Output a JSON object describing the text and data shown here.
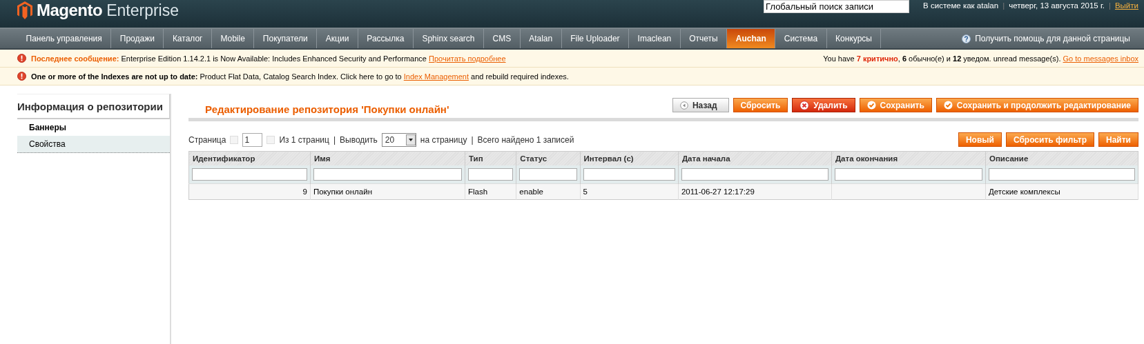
{
  "header": {
    "logo": "Magento",
    "logo_suffix": "Enterprise",
    "search_value": "Глобальный поиск записи",
    "user": "В системе как atalan",
    "sep": "|",
    "date": "четверг, 13 августа 2015 г.",
    "sep2": "|",
    "logout": "Выйти"
  },
  "nav": {
    "items": [
      {
        "label": "Панель управления",
        "selected": false
      },
      {
        "label": "Продажи",
        "selected": false
      },
      {
        "label": "Каталог",
        "selected": false
      },
      {
        "label": "Mobile",
        "selected": false
      },
      {
        "label": "Покупатели",
        "selected": false
      },
      {
        "label": "Акции",
        "selected": false
      },
      {
        "label": "Рассылка",
        "selected": false
      },
      {
        "label": "Sphinx search",
        "selected": false
      },
      {
        "label": "CMS",
        "selected": false
      },
      {
        "label": "Atalan",
        "selected": false
      },
      {
        "label": "File Uploader",
        "selected": false
      },
      {
        "label": "Imaclean",
        "selected": false
      },
      {
        "label": "Отчеты",
        "selected": false
      },
      {
        "label": "Auchan",
        "selected": true
      },
      {
        "label": "Система",
        "selected": false
      },
      {
        "label": "Конкурсы",
        "selected": false
      }
    ],
    "help": "Получить помощь для данной страницы"
  },
  "messages": [
    {
      "lead": "Последнее сообщение:",
      "text": "Enterprise Edition 1.14.2.1 is Now Available: Includes Enhanced Security and Performance",
      "link": "Прочитать подробнее",
      "summary": [
        {
          "kind": "plain",
          "text": "You have "
        },
        {
          "kind": "critical",
          "text": "7 критично"
        },
        {
          "kind": "plain",
          "text": ", "
        },
        {
          "kind": "bold",
          "text": "6"
        },
        {
          "kind": "plain",
          "text": " обычно(е) и "
        },
        {
          "kind": "bold",
          "text": "12"
        },
        {
          "kind": "plain",
          "text": " уведом. unread message(s). "
        }
      ],
      "summary_link": "Go to messages inbox"
    },
    {
      "lead": "One or more of the Indexes are not up to date:",
      "text": "Product Flat Data, Catalog Search Index. Click here to go to",
      "link": "Index Management",
      "after": "and rebuild required indexes."
    }
  ],
  "sidebar": {
    "title": "Информация о репозитории",
    "items": [
      {
        "label": "Баннеры",
        "selected": true
      },
      {
        "label": "Свойства",
        "selected": false
      }
    ]
  },
  "page": {
    "title": "Редактирование репозитория 'Покупки онлайн'",
    "buttons": [
      {
        "kind": "back",
        "label": "Назад"
      },
      {
        "kind": "plain",
        "label": "Сбросить"
      },
      {
        "kind": "delete",
        "label": "Удалить"
      },
      {
        "kind": "save",
        "label": "Сохранить"
      },
      {
        "kind": "save",
        "label": "Сохранить и продолжить редактирование"
      }
    ]
  },
  "pager": {
    "page_label": "Страница",
    "page": "1",
    "of": "Из 1 страниц",
    "sep": "|",
    "show_label": "Выводить",
    "per_page": "20",
    "per_page_suffix": "на страницу",
    "sep2": "|",
    "total": "Всего найдено 1 записей",
    "buttons": [
      "Новый",
      "Сбросить фильтр",
      "Найти"
    ]
  },
  "table": {
    "columns": [
      "Идентификатор",
      "Имя",
      "Тип",
      "Статус",
      "Интервал (c)",
      "Дата начала",
      "Дата окончания",
      "Описание"
    ],
    "rows": [
      [
        "9",
        "Покупки онлайн",
        "Flash",
        "enable",
        "5",
        "2011-06-27 12:17:29",
        "",
        "Детские комплексы"
      ]
    ]
  }
}
